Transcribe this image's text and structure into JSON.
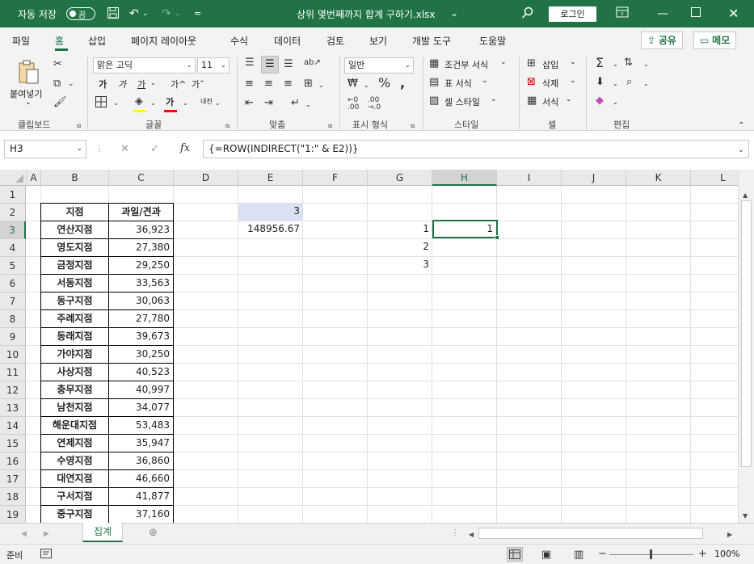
{
  "titlebar": {
    "autosave_label": "자동 저장",
    "autosave_state": "끔",
    "filename": "상위 몇번째까지 합계 구하기.xlsx",
    "filename_suffix": "⌄",
    "login_label": "로그인"
  },
  "menu": {
    "tabs": [
      "파일",
      "홈",
      "삽입",
      "페이지 레이아웃",
      "수식",
      "데이터",
      "검토",
      "보기",
      "개발 도구",
      "도움말"
    ],
    "active_tab": "홈",
    "share_label": "공유",
    "memo_label": "메모"
  },
  "ribbon": {
    "clipboard": {
      "paste_label": "붙여넣기",
      "group_label": "클립보드"
    },
    "font": {
      "font_name": "맑은 고딕",
      "font_size": "11",
      "group_label": "글꼴",
      "bold": "가",
      "italic": "가",
      "underline": "가",
      "grow": "가^",
      "shrink": "가ˇ",
      "phonetic": "내천"
    },
    "alignment": {
      "group_label": "맞춤"
    },
    "number": {
      "format": "일반",
      "group_label": "표시 형식"
    },
    "styles": {
      "conditional": "조건부 서식",
      "table": "표 서식",
      "cell_style": "셀 스타일",
      "group_label": "스타일"
    },
    "cells": {
      "insert": "삽입",
      "delete": "삭제",
      "format": "서식",
      "group_label": "셀"
    },
    "editing": {
      "group_label": "편집"
    }
  },
  "formula_bar": {
    "name_box": "H3",
    "formula": "{=ROW(INDIRECT(\"1:\" & E2))}"
  },
  "grid": {
    "columns": [
      "A",
      "B",
      "C",
      "D",
      "E",
      "F",
      "G",
      "H",
      "I",
      "J",
      "K",
      "L"
    ],
    "rows": [
      "1",
      "2",
      "3",
      "4",
      "5",
      "6",
      "7",
      "8",
      "9",
      "10",
      "11",
      "12",
      "13",
      "14",
      "15",
      "16",
      "17",
      "18",
      "19"
    ],
    "table_header": {
      "branch": "지점",
      "value": "과일/견과"
    },
    "table_rows": [
      {
        "branch": "연산지점",
        "value": "36,923"
      },
      {
        "branch": "영도지점",
        "value": "27,380"
      },
      {
        "branch": "금정지점",
        "value": "29,250"
      },
      {
        "branch": "서동지점",
        "value": "33,563"
      },
      {
        "branch": "동구지점",
        "value": "30,063"
      },
      {
        "branch": "주례지점",
        "value": "27,780"
      },
      {
        "branch": "동래지점",
        "value": "39,673"
      },
      {
        "branch": "가야지점",
        "value": "30,250"
      },
      {
        "branch": "사상지점",
        "value": "40,523"
      },
      {
        "branch": "충무지점",
        "value": "40,997"
      },
      {
        "branch": "남천지점",
        "value": "34,077"
      },
      {
        "branch": "해운대지점",
        "value": "53,483"
      },
      {
        "branch": "연제지점",
        "value": "35,947"
      },
      {
        "branch": "수영지점",
        "value": "36,860"
      },
      {
        "branch": "대연지점",
        "value": "46,660"
      },
      {
        "branch": "구서지점",
        "value": "41,877"
      },
      {
        "branch": "중구지점",
        "value": "37,160"
      }
    ],
    "E2": "3",
    "E3": "148956.67",
    "G3": "1",
    "G4": "2",
    "G5": "3",
    "H3": "1"
  },
  "sheets": {
    "tabs": [
      "집계"
    ],
    "active": "집계"
  },
  "status": {
    "mode": "준비",
    "zoom": "100%"
  },
  "colors": {
    "accent": "#217346",
    "selected_cell_fill": "#d9e1f2"
  }
}
